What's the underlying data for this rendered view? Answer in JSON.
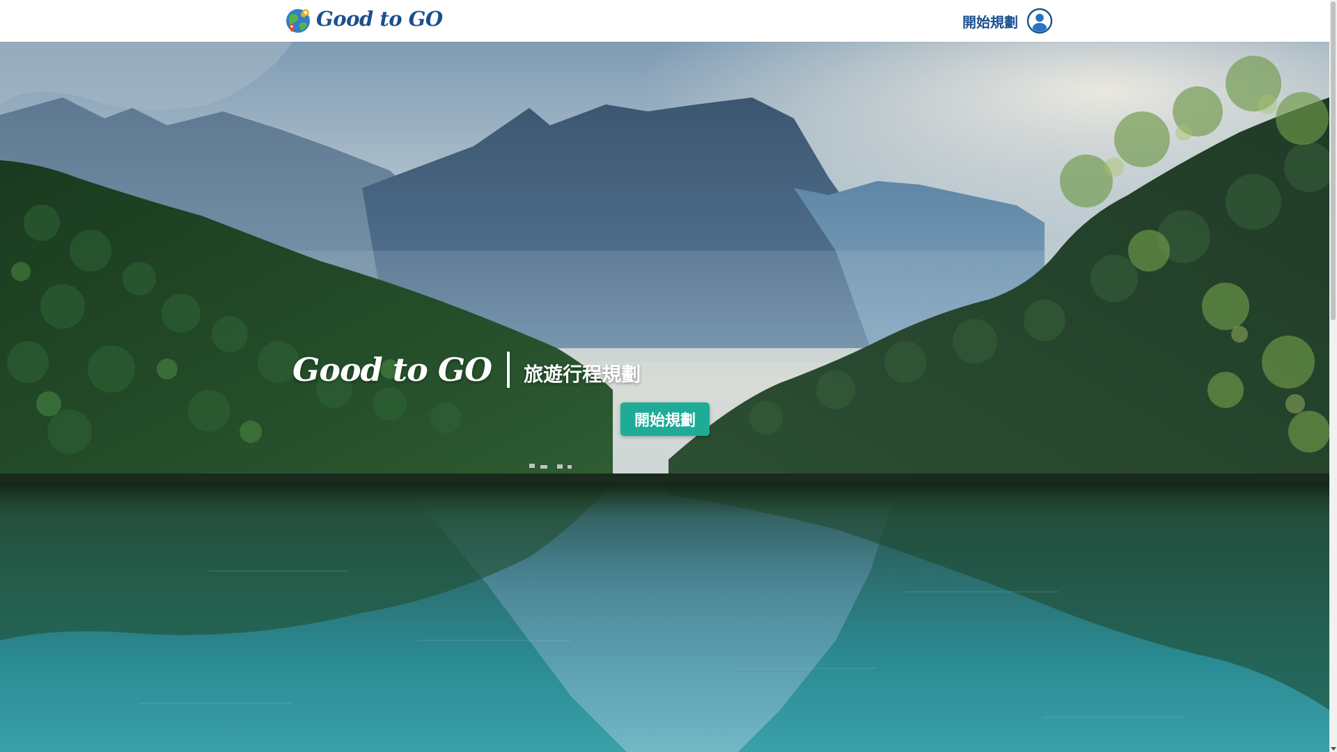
{
  "header": {
    "brand_name": "Good to GO",
    "brand_logo_icon": "globe-pin-icon",
    "nav_link_label": "開始規劃",
    "user_icon": "user-circle-icon",
    "brand_color": "#1b4f8f"
  },
  "hero": {
    "title": "Good to GO",
    "subtitle": "旅遊行程規劃",
    "cta_label": "開始規劃",
    "cta_color": "#1eab98",
    "background_image": "mountain-lake-landscape"
  },
  "scrollbar": {
    "thumb_color": "#c1c1c1"
  }
}
